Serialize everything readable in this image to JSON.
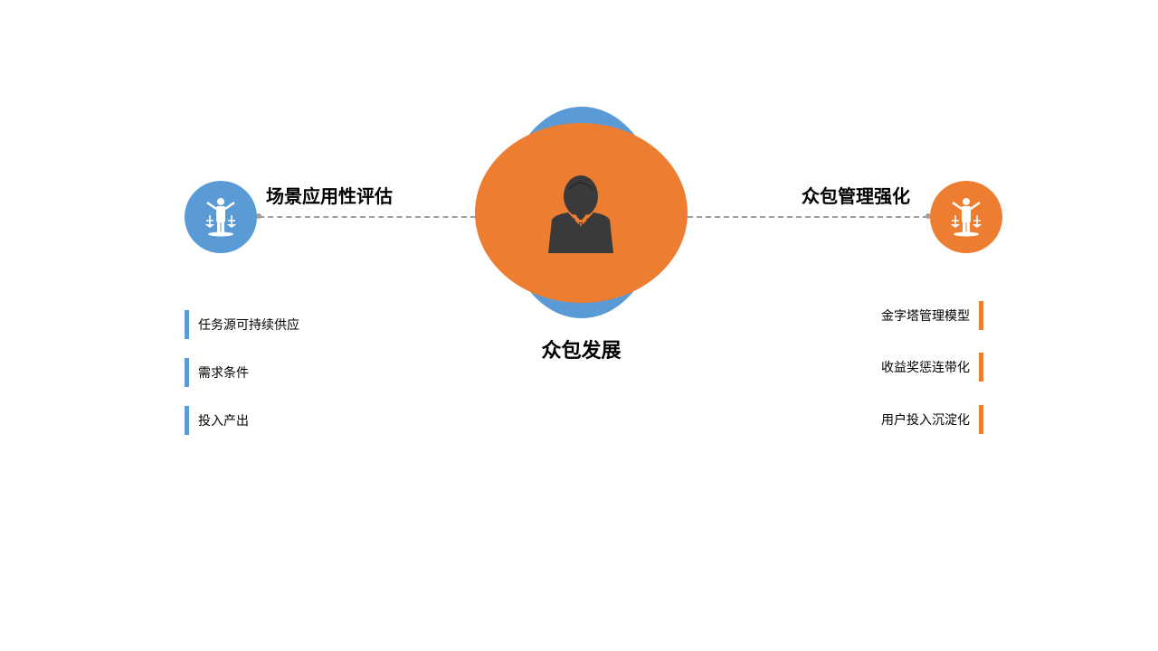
{
  "colors": {
    "blue": "#5b9bd5",
    "orange": "#ed7d31",
    "icon_dark": "#3a3a3a",
    "line": "#9e9e9e"
  },
  "center": {
    "title": "众包发展",
    "icon": "businessman-icon"
  },
  "left": {
    "heading": "场景应用性评估",
    "icon": "justice-balance-icon",
    "items": [
      "任务源可持续供应",
      "需求条件",
      "投入产出"
    ]
  },
  "right": {
    "heading": "众包管理强化",
    "icon": "justice-balance-icon",
    "items": [
      "金字塔管理模型",
      "收益奖惩连带化",
      "用户投入沉淀化"
    ]
  }
}
